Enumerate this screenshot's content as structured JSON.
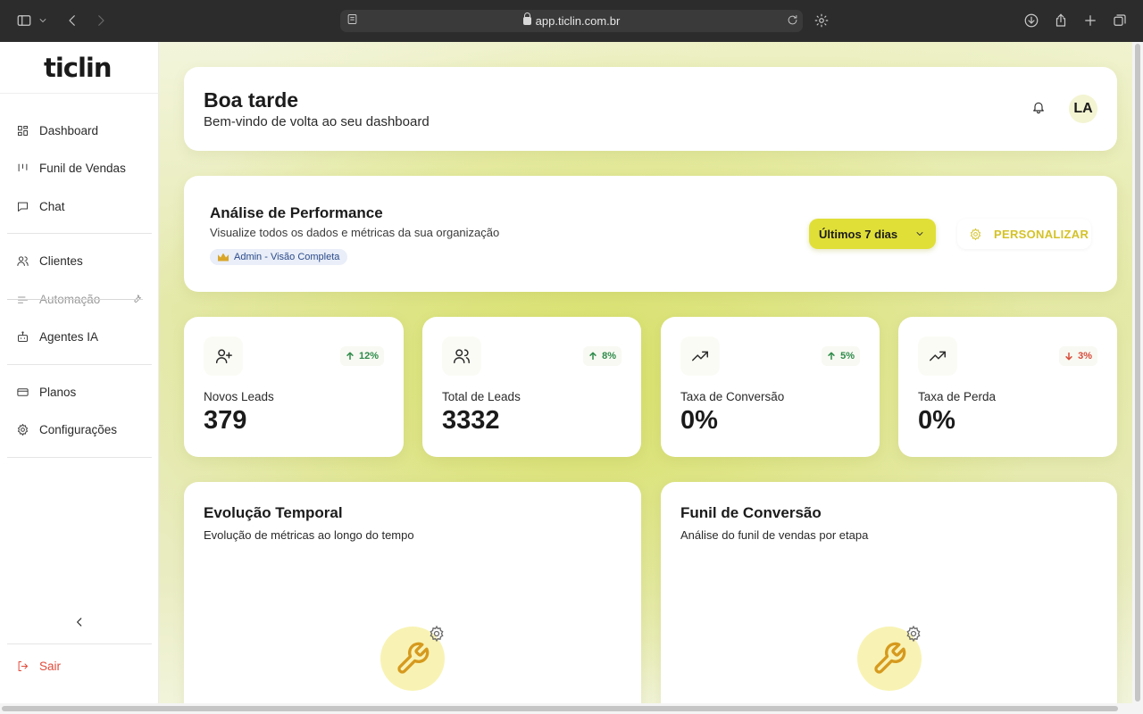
{
  "browser": {
    "url": "app.ticlin.com.br"
  },
  "sidebar": {
    "logo": "ticlin",
    "items": [
      {
        "label": "Dashboard",
        "icon": "dashboard-icon"
      },
      {
        "label": "Funil de Vendas",
        "icon": "kanban-icon"
      },
      {
        "label": "Chat",
        "icon": "chat-icon"
      },
      {
        "label": "Clientes",
        "icon": "users-icon"
      },
      {
        "label": "Automação",
        "icon": "automation-icon",
        "disabled": true
      },
      {
        "label": "Agentes IA",
        "icon": "bot-icon"
      },
      {
        "label": "Planos",
        "icon": "credit-card-icon"
      },
      {
        "label": "Configurações",
        "icon": "gear-icon"
      }
    ],
    "logout_label": "Sair"
  },
  "header": {
    "greeting": "Boa tarde",
    "subtitle": "Bem-vindo de volta ao seu dashboard",
    "avatar_initials": "LA"
  },
  "performance": {
    "title": "Análise de Performance",
    "subtitle": "Visualize todos os dados e métricas da sua organização",
    "badge": "Admin - Visão Completa",
    "period_selected": "Últimos 7 dias",
    "customize_label": "PERSONALIZAR"
  },
  "stats": [
    {
      "label": "Novos Leads",
      "value": "379",
      "trend": "12%",
      "direction": "up",
      "icon": "user-plus-icon"
    },
    {
      "label": "Total de Leads",
      "value": "3332",
      "trend": "8%",
      "direction": "up",
      "icon": "users-icon"
    },
    {
      "label": "Taxa de Conversão",
      "value": "0%",
      "trend": "5%",
      "direction": "up",
      "icon": "trending-up-icon"
    },
    {
      "label": "Taxa de Perda",
      "value": "0%",
      "trend": "3%",
      "direction": "down",
      "icon": "trending-up-icon"
    }
  ],
  "charts": [
    {
      "title": "Evolução Temporal",
      "subtitle": "Evolução de métricas ao longo do tempo"
    },
    {
      "title": "Funil de Conversão",
      "subtitle": "Análise do funil de vendas por etapa"
    }
  ],
  "colors": {
    "accent": "#e0df38",
    "accent_text": "#d4c228",
    "trend_up": "#2e8b4a",
    "trend_down": "#d94a3a",
    "logout": "#e14b3b"
  }
}
